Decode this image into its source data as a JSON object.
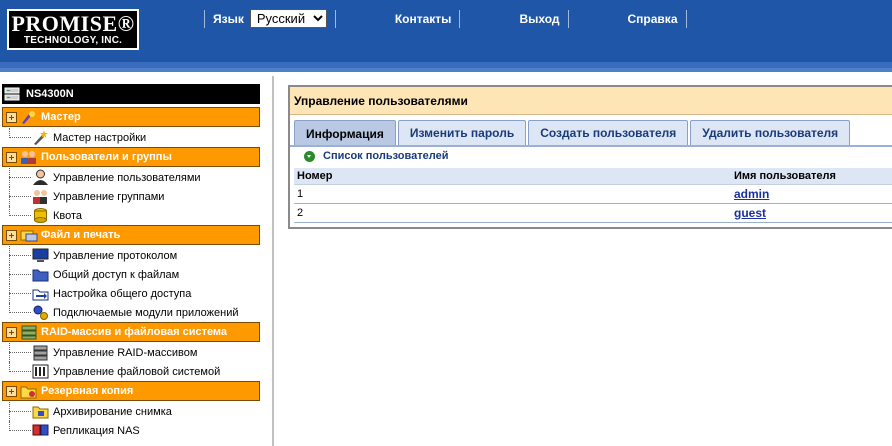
{
  "header": {
    "logo_line1": "PROMISE®",
    "logo_line2": "TECHNOLOGY, INC.",
    "lang_label": "Язык",
    "lang_selected": "Русский",
    "nav": [
      "Контакты",
      "Выход",
      "Справка"
    ]
  },
  "sidebar": {
    "device": "NS4300N",
    "groups": [
      {
        "label": "Мастер",
        "items": [
          "Мастер настройки"
        ]
      },
      {
        "label": "Пользователи и группы",
        "items": [
          "Управление пользователями",
          "Управление группами",
          "Квота"
        ]
      },
      {
        "label": "Файл и печать",
        "items": [
          "Управление протоколом",
          "Общий доступ к файлам",
          "Настройка общего доступа",
          "Подключаемые модули приложений"
        ]
      },
      {
        "label": "RAID-массив и файловая система",
        "items": [
          "Управление RAID-массивом",
          "Управление файловой системой"
        ]
      },
      {
        "label": "Резервная копия",
        "items": [
          "Архивирование снимка",
          "Репликация NAS"
        ]
      }
    ]
  },
  "main": {
    "title": "Управление пользователями",
    "tabs": [
      "Информация",
      "Изменить пароль",
      "Создать пользователя",
      "Удалить пользователя"
    ],
    "list_title": "Список пользователей",
    "columns": [
      "Номер",
      "Имя пользователя"
    ],
    "rows": [
      {
        "num": "1",
        "name": "admin"
      },
      {
        "num": "2",
        "name": "guest"
      }
    ]
  },
  "colors": {
    "header": "#1f56a8",
    "group": "#ff9900",
    "tab_active": "#b9c9e3",
    "panel_title": "#fde5b6"
  }
}
